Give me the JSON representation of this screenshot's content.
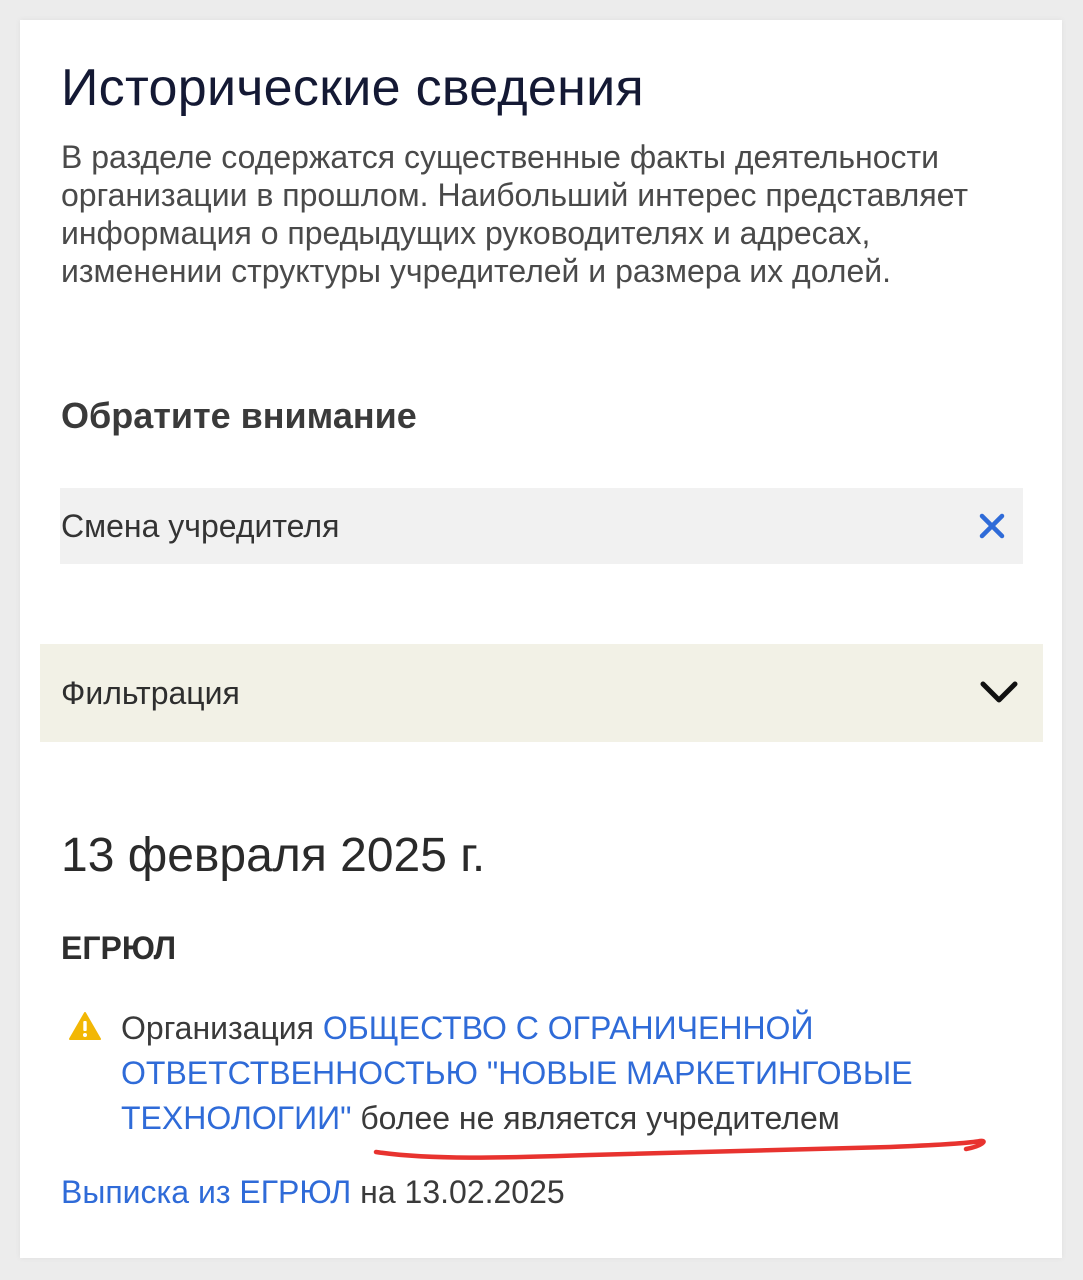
{
  "page": {
    "title": "Исторические сведения",
    "intro": "В разделе содержатся существенные факты деятельности организации в прошлом. Наибольший интерес представляет информация о предыдущих руководителях и адресах, изменении структуры учредителей и размера их долей."
  },
  "notice": {
    "heading": "Обратите внимание",
    "active_filter": {
      "label": "Смена учредителя",
      "remove_icon": "close-icon"
    }
  },
  "filter_panel": {
    "label": "Фильтрация",
    "toggle_icon": "chevron-down-icon"
  },
  "event": {
    "date": "13 февраля 2025 г.",
    "source": "ЕГРЮЛ",
    "icon": "warning-icon",
    "text_prefix": "Организация ",
    "organization_link": "ОБЩЕСТВО С ОГРАНИЧЕННОЙ ОТВЕТСТВЕННОСТЬЮ \"НОВЫЕ МАРКЕТИНГОВЫЕ ТЕХНОЛОГИИ\"",
    "text_suffix": " более не является учредителем"
  },
  "extract": {
    "link_label": "Выписка из ЕГРЮЛ",
    "suffix": " на 13.02.2025"
  },
  "colors": {
    "link": "#2f6bd8",
    "warning": "#f2b705",
    "highlight_stroke": "#e8332f",
    "filter_panel_bg": "#f2f1e6",
    "chip_bg": "#f1f1f1"
  }
}
